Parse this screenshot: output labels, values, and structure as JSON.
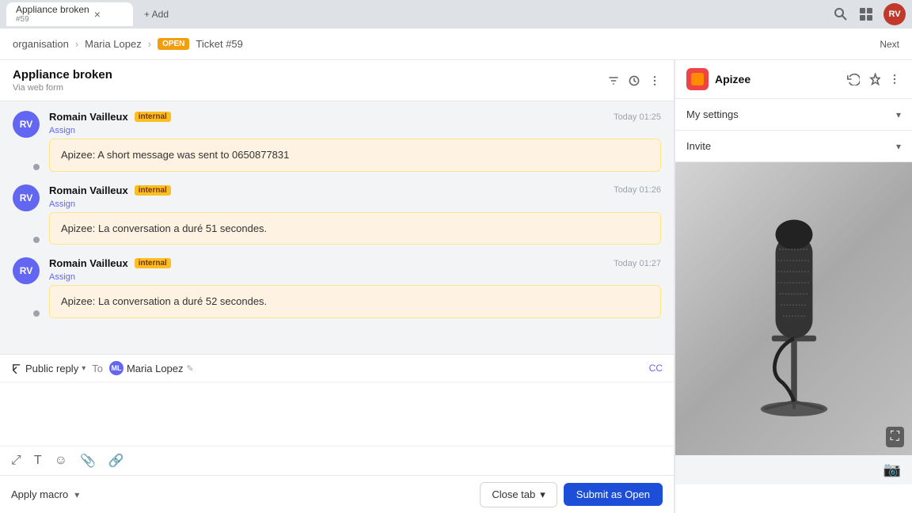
{
  "tab": {
    "title": "Appliance broken",
    "subtitle": "#59",
    "close_label": "×",
    "add_label": "+ Add"
  },
  "breadcrumb": {
    "org": "organisation",
    "person": "Maria Lopez",
    "badge": "OPEN",
    "ticket": "Ticket #59",
    "next": "Next"
  },
  "ticket": {
    "title": "Appliance broken",
    "source": "Via web form"
  },
  "messages": [
    {
      "author": "Romain Vailleux",
      "badge": "internal",
      "time": "Today 01:25",
      "assign": "Assign",
      "text": "Apizee: A short message was sent to 0650877831"
    },
    {
      "author": "Romain Vailleux",
      "badge": "internal",
      "time": "Today 01:26",
      "assign": "Assign",
      "text": "Apizee: La conversation a duré 51 secondes."
    },
    {
      "author": "Romain Vailleux",
      "badge": "internal",
      "time": "Today 01:27",
      "assign": "Assign",
      "text": "Apizee: La conversation a duré 52 secondes."
    }
  ],
  "reply": {
    "type_label": "Public reply",
    "to_label": "To",
    "recipient": "Maria Lopez",
    "cc_label": "CC",
    "placeholder": ""
  },
  "bottom": {
    "apply_macro": "Apply macro",
    "close_tab": "Close tab",
    "submit": "Submit as Open"
  },
  "right_panel": {
    "title": "Apizee",
    "accordion": [
      {
        "label": "My settings"
      },
      {
        "label": "Invite"
      }
    ]
  }
}
